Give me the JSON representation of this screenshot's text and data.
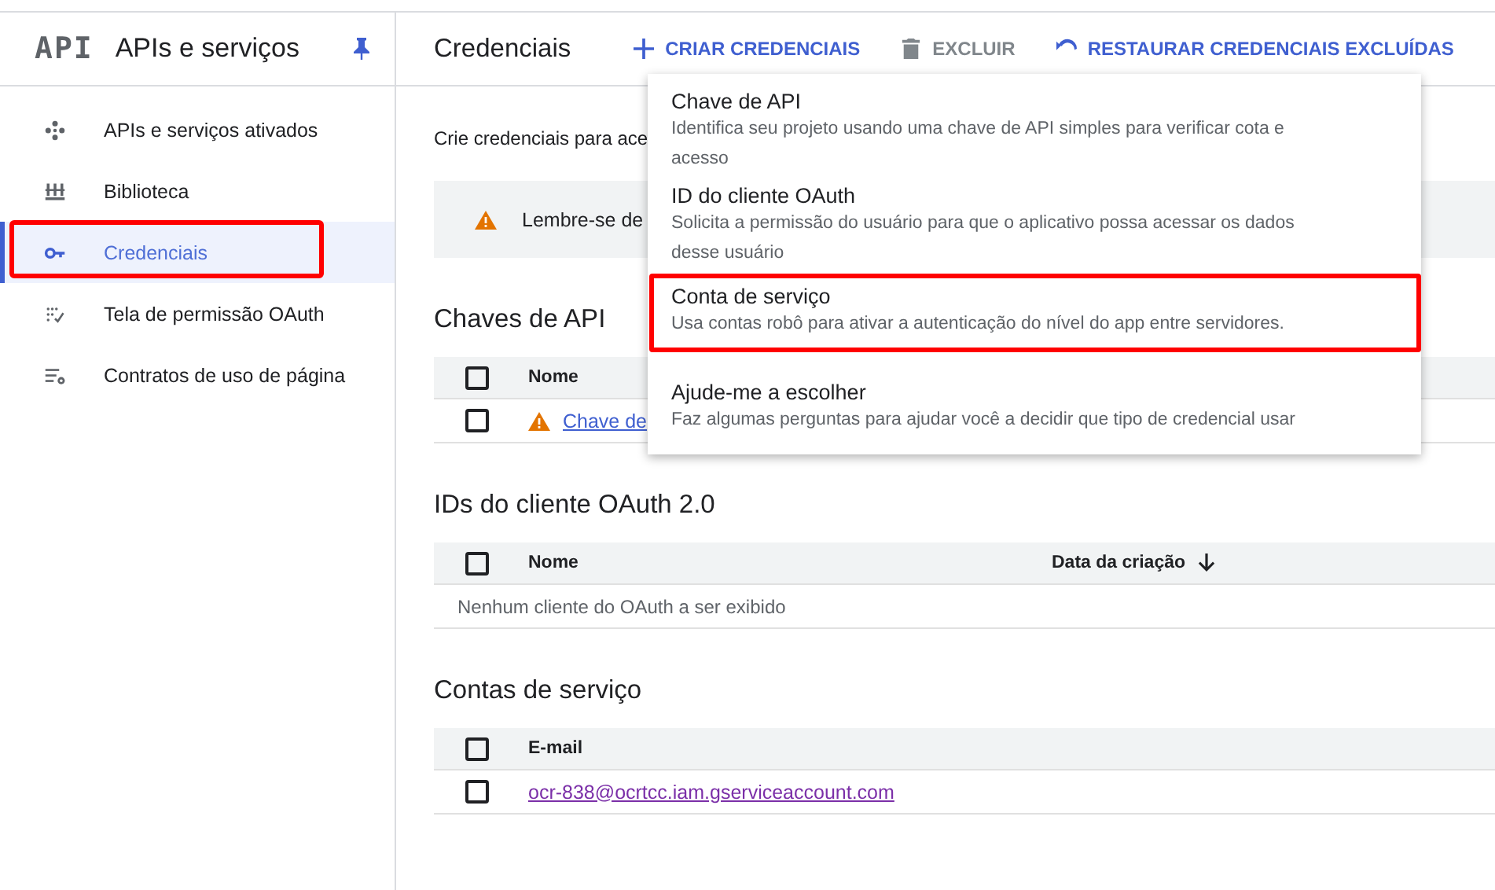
{
  "sidebar": {
    "logo": "API",
    "title": "APIs e serviços",
    "items": [
      {
        "label": "APIs e serviços ativados",
        "selected": false,
        "highlighted": false
      },
      {
        "label": "Biblioteca",
        "selected": false,
        "highlighted": false
      },
      {
        "label": "Credenciais",
        "selected": true,
        "highlighted": true
      },
      {
        "label": "Tela de permissão OAuth",
        "selected": false,
        "highlighted": false
      },
      {
        "label": "Contratos de uso de página",
        "selected": false,
        "highlighted": false
      }
    ]
  },
  "page": {
    "title": "Credenciais",
    "actions": [
      {
        "label": "CRIAR CREDENCIAIS",
        "disabled": false
      },
      {
        "label": "EXCLUIR",
        "disabled": true
      },
      {
        "label": "RESTAURAR CREDENCIAIS EXCLUÍDAS",
        "disabled": false
      }
    ]
  },
  "intro": "Crie credenciais para ace",
  "notice": "Lembre-se de",
  "sections": [
    {
      "title": "Chaves de API",
      "header_checked": false,
      "columns": [
        {
          "label": "Nome",
          "sorted": false
        }
      ],
      "rows": [
        {
          "kind": "link",
          "text": "Chave de",
          "warning": true,
          "visited": false,
          "checked": false
        }
      ]
    },
    {
      "title": "IDs do cliente OAuth 2.0",
      "header_checked": false,
      "columns": [
        {
          "label": "Nome",
          "sorted": false
        },
        {
          "label": "Data da criação",
          "sorted": true
        }
      ],
      "rows": [
        {
          "kind": "empty",
          "text": "Nenhum cliente do OAuth a ser exibido"
        }
      ]
    },
    {
      "title": "Contas de serviço",
      "header_checked": false,
      "columns": [
        {
          "label": "E-mail",
          "sorted": false
        }
      ],
      "rows": [
        {
          "kind": "link",
          "text": "ocr-838@ocrtcc.iam.gserviceaccount.com",
          "warning": false,
          "visited": true,
          "checked": false
        }
      ]
    }
  ],
  "menu": {
    "items": [
      {
        "title": "Chave de API",
        "description": "Identifica seu projeto usando uma chave de API simples para verificar cota e acesso",
        "highlighted": false
      },
      {
        "title": "ID do cliente OAuth",
        "description": "Solicita a permissão do usuário para que o aplicativo possa acessar os dados desse usuário",
        "highlighted": false
      },
      {
        "title": "Conta de serviço",
        "description": "Usa contas robô para ativar a autenticação do nível do app entre servidores.",
        "highlighted": true
      },
      {
        "title": "Ajude-me a escolher",
        "description": "Faz algumas perguntas para ajudar você a decidir que tipo de credencial usar",
        "highlighted": false
      }
    ]
  }
}
